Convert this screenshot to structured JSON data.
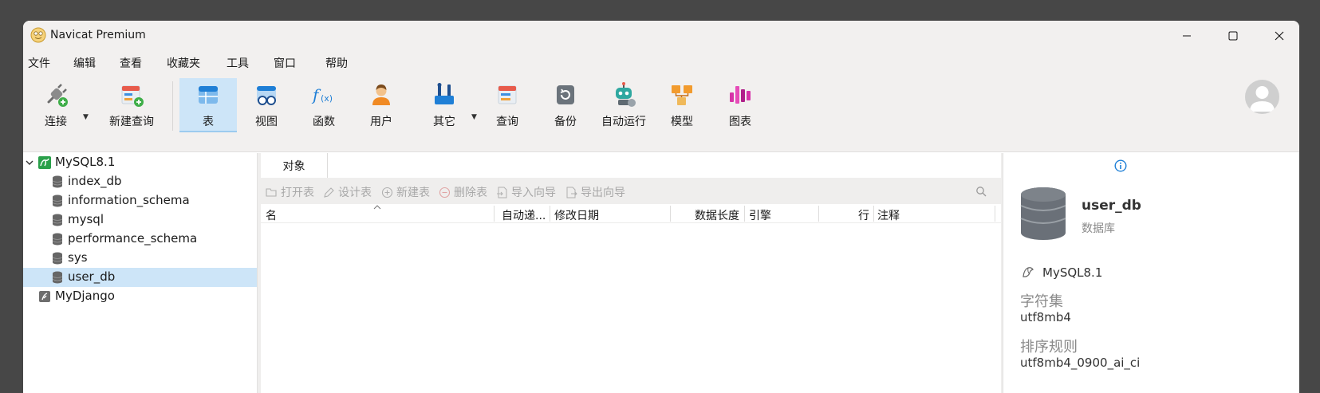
{
  "window": {
    "title": "Navicat Premium"
  },
  "menu": [
    "文件",
    "编辑",
    "查看",
    "收藏夹",
    "工具",
    "窗口",
    "帮助"
  ],
  "toolbar": {
    "connect": "连接",
    "new_query": "新建查询",
    "table": "表",
    "view": "视图",
    "function": "函数",
    "user": "用户",
    "other": "其它",
    "query": "查询",
    "backup": "备份",
    "automation": "自动运行",
    "model": "模型",
    "chart": "图表"
  },
  "tree": {
    "connection": "MySQL8.1",
    "databases": [
      "index_db",
      "information_schema",
      "mysql",
      "performance_schema",
      "sys",
      "user_db"
    ],
    "selected": "user_db",
    "connection2": "MyDjango"
  },
  "center": {
    "tab": "对象",
    "actions": {
      "open": "打开表",
      "design": "设计表",
      "new": "新建表",
      "delete": "删除表",
      "import": "导入向导",
      "export": "导出向导"
    },
    "columns": [
      "名",
      "自动递...",
      "修改日期",
      "数据长度",
      "引擎",
      "行",
      "注释"
    ]
  },
  "info": {
    "name": "user_db",
    "type": "数据库",
    "connection": "MySQL8.1",
    "charset_label": "字符集",
    "charset": "utf8mb4",
    "collation_label": "排序规则",
    "collation": "utf8mb4_0900_ai_ci"
  },
  "colors": {
    "accent": "#1e7fd6",
    "selection": "#cde5f8"
  }
}
